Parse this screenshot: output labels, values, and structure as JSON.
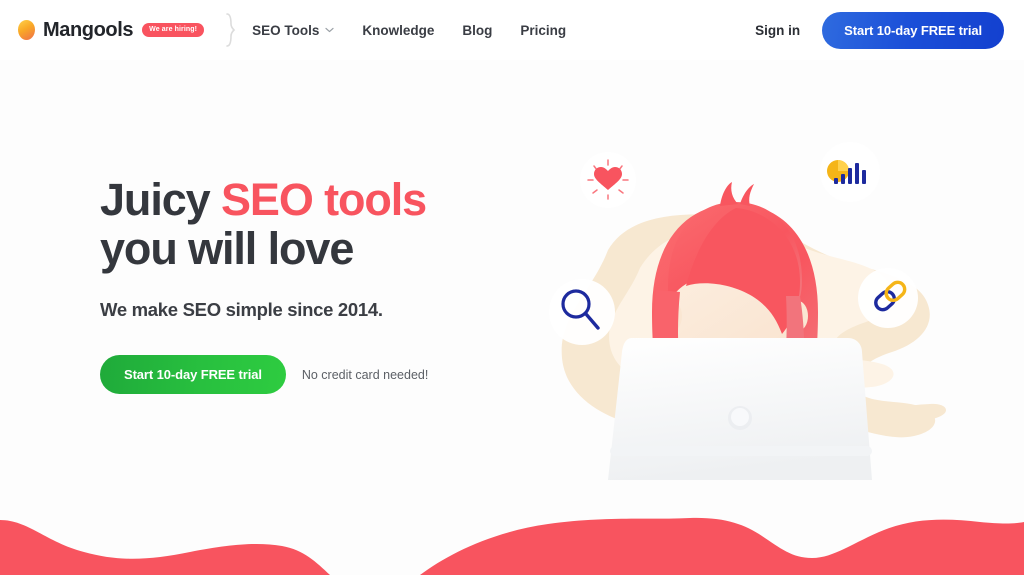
{
  "header": {
    "brand": {
      "logo_icon": "mangools-egg-logo-icon",
      "name": "Mangools",
      "hiring_badge": "We are hiring!"
    },
    "divider_icon": "curly-brace-divider-icon",
    "nav": [
      {
        "label": "SEO Tools",
        "has_dropdown": true,
        "chevron_icon": "chevron-down-icon"
      },
      {
        "label": "Knowledge",
        "has_dropdown": false
      },
      {
        "label": "Blog",
        "has_dropdown": false
      },
      {
        "label": "Pricing",
        "has_dropdown": false
      }
    ],
    "sign_in": "Sign in",
    "cta": "Start 10-day FREE trial"
  },
  "hero": {
    "headline_line1_plain": "Juicy ",
    "headline_line1_accent": "SEO tools",
    "headline_line2": "you will love",
    "subhead": "We make SEO simple since 2014.",
    "cta": "Start 10-day FREE trial",
    "cta_note": "No credit card needed!"
  },
  "illustration": {
    "name": "woman-at-laptop-illustration",
    "bubbles": [
      {
        "icon": "heart-icon",
        "position": "top-left"
      },
      {
        "icon": "bar-chart-pie-icon",
        "position": "top-right"
      },
      {
        "icon": "search-magnifier-icon",
        "position": "mid-left"
      },
      {
        "icon": "chain-link-icon",
        "position": "mid-right"
      }
    ],
    "laptop_icon": "laptop-icon"
  },
  "footer_wave": {
    "name": "coral-wave-decoration"
  },
  "colors": {
    "coral": "#f8545f",
    "blue": "#1b4fd8",
    "green": "#28c03f",
    "navy": "#1d2a9e",
    "yellow": "#f5b518",
    "cream": "#f6e3c8",
    "skin": "#fdeedd",
    "text_dark": "#34373d",
    "page_bg": "#fdfdfd"
  }
}
